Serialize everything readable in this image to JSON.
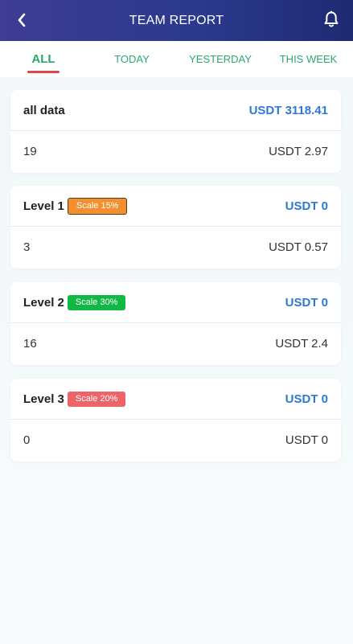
{
  "header": {
    "title": "TEAM REPORT",
    "back_icon": "chevron-left-icon",
    "bell_icon": "bell-icon"
  },
  "tabs": [
    {
      "label": "ALL",
      "active": true
    },
    {
      "label": "TODAY",
      "active": false
    },
    {
      "label": "YESTERDAY",
      "active": false
    },
    {
      "label": "THIS WEEK",
      "active": false
    }
  ],
  "cards": [
    {
      "label": "all data",
      "badge": "",
      "total": "USDT 3118.41",
      "count": "19",
      "amount": "USDT 2.97"
    },
    {
      "label": "Level 1",
      "badge": "Scale 15%",
      "badge_color": "#f28f2e",
      "total": "USDT 0",
      "count": "3",
      "amount": "USDT 0.57"
    },
    {
      "label": "Level 2",
      "badge": "Scale 30%",
      "badge_color": "#12b845",
      "total": "USDT 0",
      "count": "16",
      "amount": "USDT 2.4"
    },
    {
      "label": "Level 3",
      "badge": "Scale 20%",
      "badge_color": "#ec6467",
      "total": "USDT 0",
      "count": "0",
      "amount": "USDT 0"
    }
  ],
  "colors": {
    "accent_blue": "#2f78d6",
    "tab_green": "#26a86c",
    "tab_underline": "#e0454c"
  }
}
